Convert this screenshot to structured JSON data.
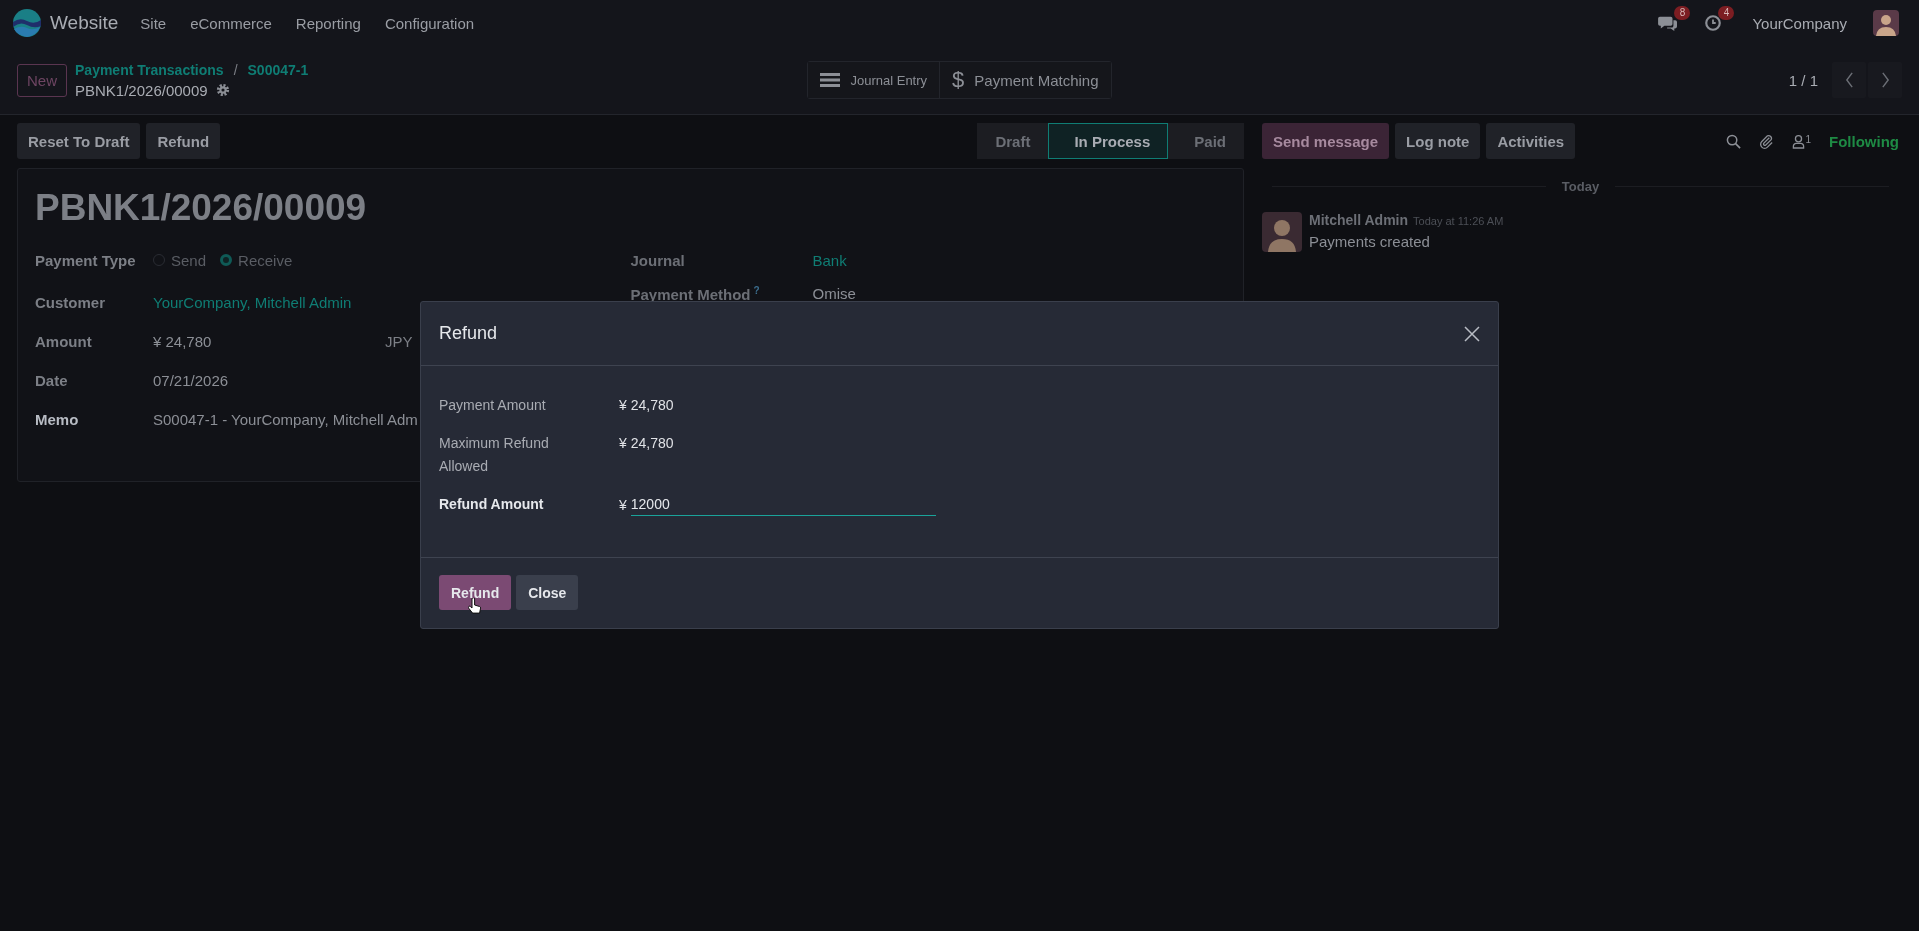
{
  "navbar": {
    "app_name": "Website",
    "menu": [
      "Site",
      "eCommerce",
      "Reporting",
      "Configuration"
    ],
    "messages_badge": "8",
    "activities_badge": "4",
    "company": "YourCompany"
  },
  "control_panel": {
    "new_button": "New",
    "breadcrumbs": [
      "Payment Transactions",
      "S00047-1"
    ],
    "separator": "/",
    "record_name": "PBNK1/2026/00009",
    "smart_buttons": [
      {
        "label": "Journal Entry",
        "kind": "lines"
      },
      {
        "label": "Payment Matching",
        "kind": "glyph",
        "glyph": "$"
      }
    ],
    "pager": "1 / 1"
  },
  "actions": [
    "Reset To Draft",
    "Refund"
  ],
  "statusbar": [
    {
      "label": "Draft",
      "selected": false
    },
    {
      "label": "In Process",
      "selected": true
    },
    {
      "label": "Paid",
      "selected": false
    }
  ],
  "form": {
    "title": "PBNK1/2026/00009",
    "payment_type": {
      "label": "Payment Type",
      "options": [
        {
          "label": "Send",
          "selected": false
        },
        {
          "label": "Receive",
          "selected": true
        }
      ]
    },
    "left_fields": [
      {
        "label": "Customer",
        "value": "YourCompany, Mitchell Admin",
        "kind": "link",
        "emphasized": false
      },
      {
        "label": "Amount",
        "value": "¥ 24,780",
        "currency": "JPY",
        "kind": "text",
        "emphasized": false
      },
      {
        "label": "Date",
        "value": "07/21/2026",
        "kind": "text",
        "emphasized": false
      },
      {
        "label": "Memo",
        "value": "S00047-1 - YourCompany, Mitchell Adm",
        "kind": "text",
        "emphasized": true
      }
    ],
    "right_fields": [
      {
        "label": "Journal",
        "value": "Bank",
        "kind": "link"
      },
      {
        "label": "Payment Method",
        "help": "?",
        "value": "Omise",
        "kind": "text"
      }
    ]
  },
  "chatter": {
    "buttons": [
      {
        "label": "Send message",
        "kind": "primary"
      },
      {
        "label": "Log note",
        "kind": "secondary"
      },
      {
        "label": "Activities",
        "kind": "secondary"
      }
    ],
    "followers_count": "1",
    "follow_status": "Following",
    "date_separator": "Today",
    "messages": [
      {
        "author": "Mitchell Admin",
        "time": "Today at 11:26 AM",
        "body": "Payments created"
      }
    ]
  },
  "dialog": {
    "title": "Refund",
    "fields": [
      {
        "label": "Payment Amount",
        "value": "¥ 24,780",
        "kind": "readonly"
      },
      {
        "label": "Maximum Refund Allowed",
        "value": "¥ 24,780",
        "kind": "readonly"
      },
      {
        "label": "Refund Amount",
        "currency": "¥",
        "value": "12000",
        "kind": "input"
      }
    ],
    "buttons": [
      {
        "label": "Refund",
        "kind": "primary"
      },
      {
        "label": "Close",
        "kind": "secondary"
      }
    ]
  }
}
